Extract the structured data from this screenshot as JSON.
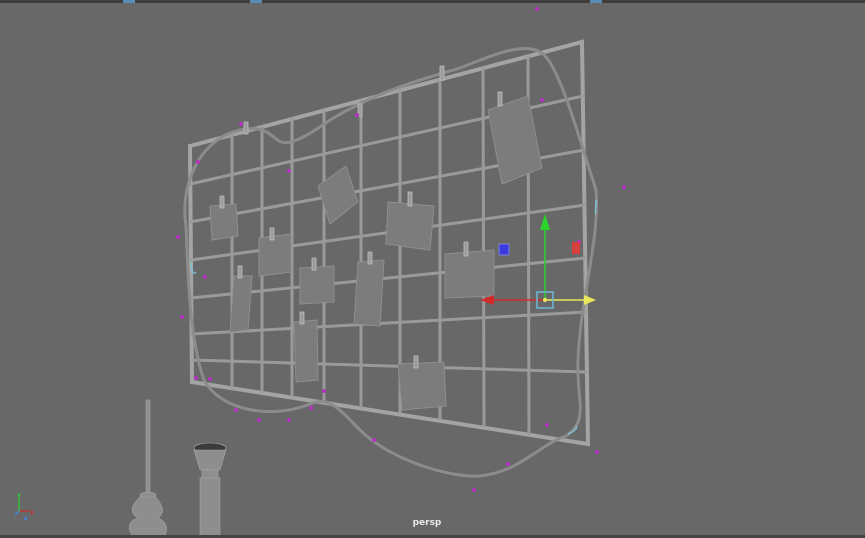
{
  "viewport": {
    "camera_label": "persp"
  },
  "axis_indicator": {
    "x_label": "x",
    "y_label": "y",
    "z_label": "z"
  },
  "colors": {
    "background": "#686868",
    "x_axis": "#d42a2a",
    "y_axis": "#2ad42a",
    "center_handle": "#e8e85a",
    "scale_handle_blue": "#3b3be0",
    "scale_handle_red": "#d84040",
    "pivot_box": "#6fb7d8",
    "selection_vertex": "#b533c4"
  }
}
